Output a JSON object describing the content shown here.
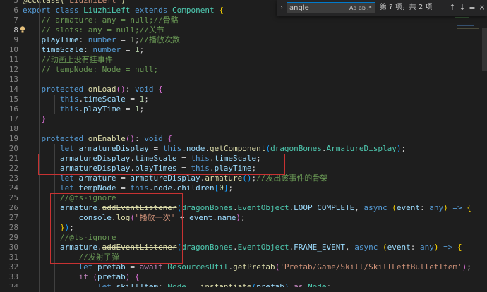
{
  "find_widget": {
    "query": "angle",
    "opt_case": "Aa",
    "opt_word": "ab",
    "opt_regex": ".*",
    "result": "第 ? 项，共 2 项",
    "toggle_glyph": "›",
    "prev_glyph": "↑",
    "next_glyph": "↓",
    "selection_glyph": "≡",
    "close_glyph": "×"
  },
  "lines": [
    {
      "n": "5",
      "code": [
        [
          "dec",
          "@ccclass("
        ],
        [
          "str",
          "'LiuzhiLeft'"
        ],
        [
          "dec",
          ")"
        ]
      ]
    },
    {
      "n": "6",
      "code": [
        [
          "kw",
          "export"
        ],
        [
          "txt",
          " "
        ],
        [
          "kw",
          "class"
        ],
        [
          "txt",
          " "
        ],
        [
          "cls",
          "LiuzhiLeft"
        ],
        [
          "txt",
          " "
        ],
        [
          "kw",
          "extends"
        ],
        [
          "txt",
          " "
        ],
        [
          "cls",
          "Component"
        ],
        [
          "txt",
          " "
        ],
        [
          "brk",
          "{"
        ]
      ]
    },
    {
      "n": "7",
      "code": [
        [
          "txt",
          "    "
        ],
        [
          "cmt",
          "// armature: any = null;//骨骼"
        ]
      ]
    },
    {
      "n": "8",
      "code": [
        [
          "txt",
          "    "
        ],
        [
          "cmt",
          "// slots: any = null;//关节"
        ]
      ],
      "bulb": true
    },
    {
      "n": "9",
      "code": [
        [
          "txt",
          "    "
        ],
        [
          "var",
          "playTime"
        ],
        [
          "txt",
          ": "
        ],
        [
          "kw",
          "number"
        ],
        [
          "txt",
          " = "
        ],
        [
          "num",
          "1"
        ],
        [
          "txt",
          ";"
        ],
        [
          "cmt",
          "//播放次数"
        ]
      ]
    },
    {
      "n": "10",
      "code": [
        [
          "txt",
          "    "
        ],
        [
          "var",
          "timeScale"
        ],
        [
          "txt",
          ": "
        ],
        [
          "kw",
          "number"
        ],
        [
          "txt",
          " = "
        ],
        [
          "num",
          "1"
        ],
        [
          "txt",
          ";"
        ]
      ]
    },
    {
      "n": "11",
      "code": [
        [
          "txt",
          "    "
        ],
        [
          "cmt",
          "//动画上没有挂事件"
        ]
      ]
    },
    {
      "n": "12",
      "code": [
        [
          "txt",
          "    "
        ],
        [
          "cmt",
          "// tempNode: Node = null;"
        ]
      ]
    },
    {
      "n": "13",
      "code": []
    },
    {
      "n": "14",
      "code": [
        [
          "txt",
          "    "
        ],
        [
          "kw",
          "protected"
        ],
        [
          "txt",
          " "
        ],
        [
          "fn",
          "onLoad"
        ],
        [
          "brk2",
          "()"
        ],
        [
          "txt",
          ": "
        ],
        [
          "kw",
          "void"
        ],
        [
          "txt",
          " "
        ],
        [
          "brk2",
          "{"
        ]
      ]
    },
    {
      "n": "15",
      "code": [
        [
          "txt",
          "        "
        ],
        [
          "kw",
          "this"
        ],
        [
          "txt",
          "."
        ],
        [
          "var",
          "timeScale"
        ],
        [
          "txt",
          " = "
        ],
        [
          "num",
          "1"
        ],
        [
          "txt",
          ";"
        ]
      ]
    },
    {
      "n": "16",
      "code": [
        [
          "txt",
          "        "
        ],
        [
          "kw",
          "this"
        ],
        [
          "txt",
          "."
        ],
        [
          "var",
          "playTime"
        ],
        [
          "txt",
          " = "
        ],
        [
          "num",
          "1"
        ],
        [
          "txt",
          ";"
        ]
      ]
    },
    {
      "n": "17",
      "code": [
        [
          "txt",
          "    "
        ],
        [
          "brk2",
          "}"
        ]
      ]
    },
    {
      "n": "18",
      "code": []
    },
    {
      "n": "19",
      "code": [
        [
          "txt",
          "    "
        ],
        [
          "kw",
          "protected"
        ],
        [
          "txt",
          " "
        ],
        [
          "fn",
          "onEnable"
        ],
        [
          "brk2",
          "()"
        ],
        [
          "txt",
          ": "
        ],
        [
          "kw",
          "void"
        ],
        [
          "txt",
          " "
        ],
        [
          "brk2",
          "{"
        ]
      ]
    },
    {
      "n": "20",
      "code": [
        [
          "txt",
          "        "
        ],
        [
          "kw",
          "let"
        ],
        [
          "txt",
          " "
        ],
        [
          "var",
          "armatureDisplay"
        ],
        [
          "txt",
          " = "
        ],
        [
          "kw",
          "this"
        ],
        [
          "txt",
          "."
        ],
        [
          "var",
          "node"
        ],
        [
          "txt",
          "."
        ],
        [
          "fn",
          "getComponent"
        ],
        [
          "brk3",
          "("
        ],
        [
          "cls",
          "dragonBones"
        ],
        [
          "txt",
          "."
        ],
        [
          "cls",
          "ArmatureDisplay"
        ],
        [
          "brk3",
          ")"
        ],
        [
          "txt",
          ";"
        ]
      ]
    },
    {
      "n": "21",
      "code": [
        [
          "txt",
          "        "
        ],
        [
          "var",
          "armatureDisplay"
        ],
        [
          "txt",
          "."
        ],
        [
          "var",
          "timeScale"
        ],
        [
          "txt",
          " = "
        ],
        [
          "kw",
          "this"
        ],
        [
          "txt",
          "."
        ],
        [
          "var",
          "timeScale"
        ],
        [
          "txt",
          ";"
        ]
      ]
    },
    {
      "n": "22",
      "code": [
        [
          "txt",
          "        "
        ],
        [
          "var",
          "armatureDisplay"
        ],
        [
          "txt",
          "."
        ],
        [
          "var",
          "playTimes"
        ],
        [
          "txt",
          " = "
        ],
        [
          "kw",
          "this"
        ],
        [
          "txt",
          "."
        ],
        [
          "var",
          "playTime"
        ],
        [
          "txt",
          ";"
        ]
      ]
    },
    {
      "n": "23",
      "code": [
        [
          "txt",
          "        "
        ],
        [
          "kw",
          "let"
        ],
        [
          "txt",
          " "
        ],
        [
          "var",
          "armature"
        ],
        [
          "txt",
          " = "
        ],
        [
          "var",
          "armatureDisplay"
        ],
        [
          "txt",
          "."
        ],
        [
          "fn",
          "armature"
        ],
        [
          "brk3",
          "()"
        ],
        [
          "txt",
          ";"
        ],
        [
          "cmt",
          "//发出该事件的骨架"
        ]
      ]
    },
    {
      "n": "24",
      "code": [
        [
          "txt",
          "        "
        ],
        [
          "kw",
          "let"
        ],
        [
          "txt",
          " "
        ],
        [
          "var",
          "tempNode"
        ],
        [
          "txt",
          " = "
        ],
        [
          "kw",
          "this"
        ],
        [
          "txt",
          "."
        ],
        [
          "var",
          "node"
        ],
        [
          "txt",
          "."
        ],
        [
          "var",
          "children"
        ],
        [
          "brk3",
          "["
        ],
        [
          "num",
          "0"
        ],
        [
          "brk3",
          "]"
        ],
        [
          "txt",
          ";"
        ]
      ]
    },
    {
      "n": "25",
      "code": [
        [
          "txt",
          "        "
        ],
        [
          "cmt",
          "//@ts-ignore"
        ]
      ]
    },
    {
      "n": "26",
      "code": [
        [
          "txt",
          "        "
        ],
        [
          "var",
          "armature"
        ],
        [
          "txt",
          "."
        ],
        [
          "fn",
          "addEventListener",
          "strike"
        ],
        [
          "brk3",
          "("
        ],
        [
          "cls",
          "dragonBones"
        ],
        [
          "txt",
          "."
        ],
        [
          "cls",
          "EventObject"
        ],
        [
          "txt",
          "."
        ],
        [
          "var",
          "LOOP_COMPLETE"
        ],
        [
          "txt",
          ", "
        ],
        [
          "kw",
          "async"
        ],
        [
          "txt",
          " "
        ],
        [
          "brk",
          "("
        ],
        [
          "var",
          "event"
        ],
        [
          "txt",
          ": "
        ],
        [
          "kw",
          "any"
        ],
        [
          "brk",
          ")"
        ],
        [
          "txt",
          " "
        ],
        [
          "kw",
          "=>"
        ],
        [
          "txt",
          " "
        ],
        [
          "brk",
          "{"
        ]
      ]
    },
    {
      "n": "27",
      "code": [
        [
          "txt",
          "            "
        ],
        [
          "var",
          "console"
        ],
        [
          "txt",
          "."
        ],
        [
          "fn",
          "log"
        ],
        [
          "brk2",
          "("
        ],
        [
          "str",
          "\"播放一次\""
        ],
        [
          "txt",
          " + "
        ],
        [
          "var",
          "event"
        ],
        [
          "txt",
          "."
        ],
        [
          "var",
          "name"
        ],
        [
          "brk2",
          ")"
        ],
        [
          "txt",
          ";"
        ]
      ]
    },
    {
      "n": "28",
      "code": [
        [
          "txt",
          "        "
        ],
        [
          "brk",
          "}"
        ],
        [
          "brk3",
          ")"
        ],
        [
          "txt",
          ";"
        ]
      ]
    },
    {
      "n": "29",
      "code": [
        [
          "txt",
          "        "
        ],
        [
          "cmt",
          "//@ts-ignore"
        ]
      ]
    },
    {
      "n": "30",
      "code": [
        [
          "txt",
          "        "
        ],
        [
          "var",
          "armature"
        ],
        [
          "txt",
          "."
        ],
        [
          "fn",
          "addEventListener",
          "strike"
        ],
        [
          "brk3",
          "("
        ],
        [
          "cls",
          "dragonBones"
        ],
        [
          "txt",
          "."
        ],
        [
          "cls",
          "EventObject"
        ],
        [
          "txt",
          "."
        ],
        [
          "var",
          "FRAME_EVENT"
        ],
        [
          "txt",
          ", "
        ],
        [
          "kw",
          "async"
        ],
        [
          "txt",
          " "
        ],
        [
          "brk",
          "("
        ],
        [
          "var",
          "event"
        ],
        [
          "txt",
          ": "
        ],
        [
          "kw",
          "any"
        ],
        [
          "brk",
          ")"
        ],
        [
          "txt",
          " "
        ],
        [
          "kw",
          "=>"
        ],
        [
          "txt",
          " "
        ],
        [
          "brk",
          "{"
        ]
      ]
    },
    {
      "n": "31",
      "code": [
        [
          "txt",
          "            "
        ],
        [
          "cmt",
          "//发射子弹"
        ]
      ]
    },
    {
      "n": "32",
      "code": [
        [
          "txt",
          "            "
        ],
        [
          "kw",
          "let"
        ],
        [
          "txt",
          " "
        ],
        [
          "var",
          "prefab"
        ],
        [
          "txt",
          " = "
        ],
        [
          "ctl",
          "await"
        ],
        [
          "txt",
          " "
        ],
        [
          "cls",
          "ResourcesUtil"
        ],
        [
          "txt",
          "."
        ],
        [
          "fn",
          "getPrefab"
        ],
        [
          "brk2",
          "("
        ],
        [
          "str",
          "'Prefab/Game/Skill/SkillLeftBulletItem'"
        ],
        [
          "brk2",
          ")"
        ],
        [
          "txt",
          ";"
        ]
      ]
    },
    {
      "n": "33",
      "code": [
        [
          "txt",
          "            "
        ],
        [
          "ctl",
          "if"
        ],
        [
          "txt",
          " "
        ],
        [
          "brk2",
          "("
        ],
        [
          "var",
          "prefab"
        ],
        [
          "brk2",
          ")"
        ],
        [
          "txt",
          " "
        ],
        [
          "brk2",
          "{"
        ]
      ]
    },
    {
      "n": "34",
      "code": [
        [
          "txt",
          "                "
        ],
        [
          "kw",
          "let"
        ],
        [
          "txt",
          " "
        ],
        [
          "var",
          "skillItem"
        ],
        [
          "txt",
          ": "
        ],
        [
          "cls",
          "Node"
        ],
        [
          "txt",
          " = "
        ],
        [
          "fn",
          "instantiate"
        ],
        [
          "brk3",
          "("
        ],
        [
          "var",
          "prefab"
        ],
        [
          "brk3",
          ")"
        ],
        [
          "txt",
          " "
        ],
        [
          "ctl",
          "as"
        ],
        [
          "txt",
          " "
        ],
        [
          "cls",
          "Node"
        ],
        [
          "txt",
          ";"
        ]
      ]
    }
  ]
}
